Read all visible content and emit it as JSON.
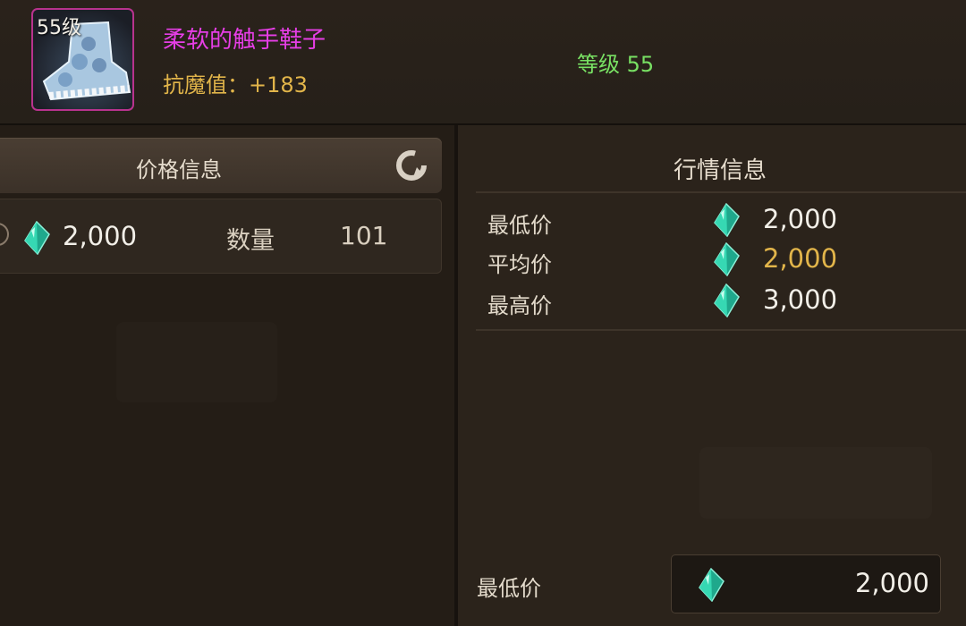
{
  "item": {
    "level_tag": "55级",
    "name": "柔软的触手鞋子",
    "stat": "抗魔值：+183",
    "requirement": "等级 55"
  },
  "price_panel": {
    "title": "价格信息",
    "listing": {
      "price": "2,000",
      "quantity_label": "数量",
      "quantity": "101"
    }
  },
  "market_panel": {
    "title": "行情信息",
    "stats": [
      {
        "label": "最低价",
        "value": "2,000"
      },
      {
        "label": "平均价",
        "value": "2,000"
      },
      {
        "label": "最高价",
        "value": "3,000"
      }
    ]
  },
  "footer": {
    "label": "最低价",
    "value": "2,000"
  },
  "colors": {
    "item_name": "#e63ee6",
    "stat_text": "#e2b54a",
    "requirement": "#78e063",
    "average_value": "#e2b54a",
    "gem": "#28c9a4"
  },
  "icons": [
    "crystal-gem-icon",
    "refresh-icon",
    "boot-item-icon"
  ]
}
